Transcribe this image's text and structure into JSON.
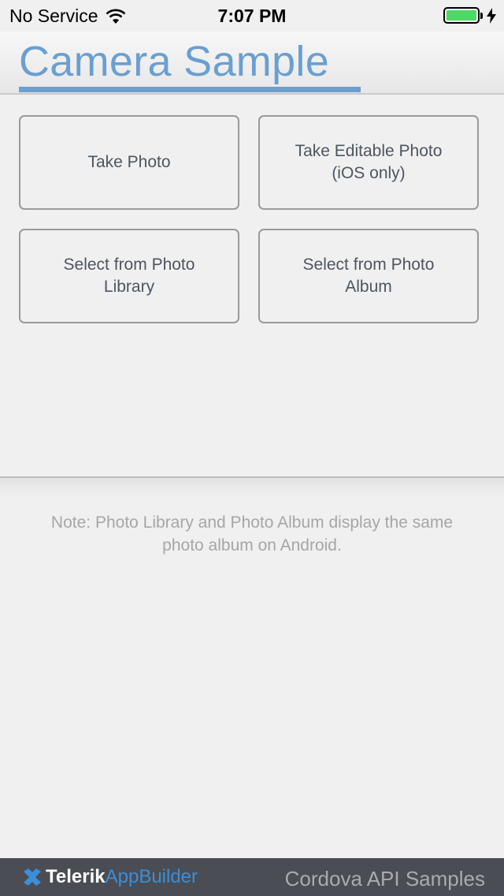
{
  "status_bar": {
    "carrier": "No Service",
    "time": "7:07 PM"
  },
  "header": {
    "title": "Camera Sample"
  },
  "buttons": [
    {
      "label": "Take Photo"
    },
    {
      "label": "Take Editable Photo\n(iOS only)"
    },
    {
      "label": "Select from Photo\nLibrary"
    },
    {
      "label": "Select from Photo\nAlbum"
    }
  ],
  "note": "Note: Photo Library and Photo Album display the same photo album on Android.",
  "footer": {
    "brand_telerik": "Telerik",
    "brand_appbuilder": "AppBuilder",
    "right_text": "Cordova API Samples"
  },
  "colors": {
    "accent": "#6a9fd0",
    "battery": "#4cd964",
    "footer_bg": "#4a4d54"
  }
}
